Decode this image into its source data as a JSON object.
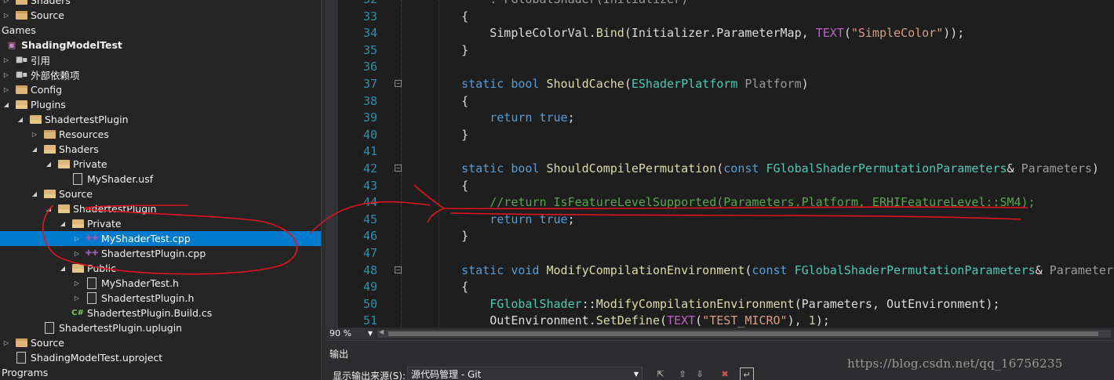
{
  "explorer": {
    "rows": [
      {
        "label": "Shaders",
        "indent": 0,
        "twisty": "closed",
        "icon": "folder",
        "bold": false
      },
      {
        "label": "Source",
        "indent": 0,
        "twisty": "closed",
        "icon": "folder",
        "bold": false
      },
      {
        "label": "Games",
        "indent": -1,
        "twisty": "none",
        "icon": "none",
        "bold": false
      },
      {
        "label": "ShadingModelTest",
        "indent": -1,
        "twisty": "none",
        "icon": "project",
        "bold": true
      },
      {
        "label": "引用",
        "indent": 0,
        "twisty": "closed",
        "icon": "reference",
        "bold": false
      },
      {
        "label": "外部依赖项",
        "indent": 0,
        "twisty": "closed",
        "icon": "reference",
        "bold": false
      },
      {
        "label": "Config",
        "indent": 0,
        "twisty": "closed",
        "icon": "folder",
        "bold": false
      },
      {
        "label": "Plugins",
        "indent": 0,
        "twisty": "open",
        "icon": "folder-open",
        "bold": false
      },
      {
        "label": "ShadertestPlugin",
        "indent": 1,
        "twisty": "open",
        "icon": "folder-open",
        "bold": false
      },
      {
        "label": "Resources",
        "indent": 2,
        "twisty": "closed",
        "icon": "folder",
        "bold": false
      },
      {
        "label": "Shaders",
        "indent": 2,
        "twisty": "open",
        "icon": "folder-open",
        "bold": false
      },
      {
        "label": "Private",
        "indent": 3,
        "twisty": "open",
        "icon": "folder-open",
        "bold": false
      },
      {
        "label": "MyShader.usf",
        "indent": 4,
        "twisty": "none",
        "icon": "file",
        "bold": false
      },
      {
        "label": "Source",
        "indent": 2,
        "twisty": "open",
        "icon": "folder-open",
        "bold": false
      },
      {
        "label": "ShadertestPlugin",
        "indent": 3,
        "twisty": "open",
        "icon": "folder-open",
        "bold": false
      },
      {
        "label": "Private",
        "indent": 4,
        "twisty": "open",
        "icon": "folder-open",
        "bold": false
      },
      {
        "label": "MyShaderTest.cpp",
        "indent": 5,
        "twisty": "closed",
        "icon": "cpp",
        "bold": false,
        "selected": true
      },
      {
        "label": "ShadertestPlugin.cpp",
        "indent": 5,
        "twisty": "closed",
        "icon": "cpp",
        "bold": false
      },
      {
        "label": "Public",
        "indent": 4,
        "twisty": "open",
        "icon": "folder-open",
        "bold": false
      },
      {
        "label": "MyShaderTest.h",
        "indent": 5,
        "twisty": "closed",
        "icon": "file",
        "bold": false
      },
      {
        "label": "ShadertestPlugin.h",
        "indent": 5,
        "twisty": "closed",
        "icon": "file",
        "bold": false
      },
      {
        "label": "ShadertestPlugin.Build.cs",
        "indent": 4,
        "twisty": "none",
        "icon": "cs",
        "bold": false
      },
      {
        "label": "ShadertestPlugin.uplugin",
        "indent": 2,
        "twisty": "none",
        "icon": "file",
        "bold": false
      },
      {
        "label": "Source",
        "indent": 0,
        "twisty": "closed",
        "icon": "folder",
        "bold": false
      },
      {
        "label": "ShadingModelTest.uproject",
        "indent": 0,
        "twisty": "none",
        "icon": "file",
        "bold": false
      },
      {
        "label": "Programs",
        "indent": -1,
        "twisty": "none",
        "icon": "none",
        "bold": false
      }
    ]
  },
  "editor": {
    "lines": [
      {
        "n": "32",
        "fold": false,
        "segs": [
          [
            "prm",
            "        : FGlobalShader(Initializer)"
          ]
        ]
      },
      {
        "n": "33",
        "fold": false,
        "segs": [
          [
            "txt",
            "    {"
          ]
        ]
      },
      {
        "n": "34",
        "fold": false,
        "segs": [
          [
            "txt",
            "        SimpleColorVal."
          ],
          [
            "fn",
            "Bind"
          ],
          [
            "txt",
            "(Initializer.ParameterMap, "
          ],
          [
            "mac",
            "TEXT"
          ],
          [
            "txt",
            "("
          ],
          [
            "str",
            "\"SimpleColor\""
          ],
          [
            "txt",
            "));"
          ]
        ]
      },
      {
        "n": "35",
        "fold": false,
        "segs": [
          [
            "txt",
            "    }"
          ]
        ]
      },
      {
        "n": "36",
        "fold": false,
        "segs": [
          [
            "txt",
            ""
          ]
        ]
      },
      {
        "n": "37",
        "fold": true,
        "segs": [
          [
            "kw",
            "    static bool "
          ],
          [
            "fn",
            "ShouldCache"
          ],
          [
            "txt",
            "("
          ],
          [
            "ty",
            "EShaderPlatform"
          ],
          [
            "prm",
            " Platform"
          ],
          [
            "txt",
            ")"
          ]
        ]
      },
      {
        "n": "38",
        "fold": false,
        "segs": [
          [
            "txt",
            "    {"
          ]
        ]
      },
      {
        "n": "39",
        "fold": false,
        "segs": [
          [
            "kw",
            "        return true"
          ],
          [
            "txt",
            ";"
          ]
        ]
      },
      {
        "n": "40",
        "fold": false,
        "segs": [
          [
            "txt",
            "    }"
          ]
        ]
      },
      {
        "n": "41",
        "fold": false,
        "segs": [
          [
            "txt",
            ""
          ]
        ]
      },
      {
        "n": "42",
        "fold": true,
        "segs": [
          [
            "kw",
            "    static bool "
          ],
          [
            "fn",
            "ShouldCompilePermutation"
          ],
          [
            "txt",
            "("
          ],
          [
            "kw",
            "const "
          ],
          [
            "ty",
            "FGlobalShaderPermutationParameters"
          ],
          [
            "txt",
            "& "
          ],
          [
            "prm",
            "Parameters"
          ],
          [
            "txt",
            ")"
          ]
        ]
      },
      {
        "n": "43",
        "fold": false,
        "segs": [
          [
            "txt",
            "    {"
          ]
        ]
      },
      {
        "n": "44",
        "fold": false,
        "segs": [
          [
            "cm",
            "        //return IsFeatureLevelSupported(Parameters.Platform, ERHIFeatureLevel::SM4);"
          ]
        ]
      },
      {
        "n": "45",
        "fold": false,
        "segs": [
          [
            "kw",
            "        return true"
          ],
          [
            "txt",
            ";"
          ]
        ]
      },
      {
        "n": "46",
        "fold": false,
        "segs": [
          [
            "txt",
            "    }"
          ]
        ]
      },
      {
        "n": "47",
        "fold": false,
        "segs": [
          [
            "txt",
            ""
          ]
        ]
      },
      {
        "n": "48",
        "fold": true,
        "segs": [
          [
            "kw",
            "    static void "
          ],
          [
            "fn",
            "ModifyCompilationEnvironment"
          ],
          [
            "txt",
            "("
          ],
          [
            "kw",
            "const "
          ],
          [
            "ty",
            "FGlobalShaderPermutationParameters"
          ],
          [
            "txt",
            "& "
          ],
          [
            "prm",
            "Parameters"
          ]
        ]
      },
      {
        "n": "49",
        "fold": false,
        "segs": [
          [
            "txt",
            "    {"
          ]
        ]
      },
      {
        "n": "50",
        "fold": false,
        "segs": [
          [
            "ty",
            "        FGlobalShader"
          ],
          [
            "txt",
            "::"
          ],
          [
            "fn",
            "ModifyCompilationEnvironment"
          ],
          [
            "txt",
            "(Parameters, OutEnvironment);"
          ]
        ]
      },
      {
        "n": "51",
        "fold": false,
        "segs": [
          [
            "txt",
            "        OutEnvironment."
          ],
          [
            "fn",
            "SetDefine"
          ],
          [
            "txt",
            "("
          ],
          [
            "mac",
            "TEXT"
          ],
          [
            "txt",
            "("
          ],
          [
            "str",
            "\"TEST_MICRO\""
          ],
          [
            "txt",
            "), "
          ],
          [
            "num",
            "1"
          ],
          [
            "txt",
            ");"
          ]
        ]
      }
    ]
  },
  "status": {
    "zoom": "90 %"
  },
  "output": {
    "title": "输出",
    "source_label": "显示输出来源(S):",
    "source_value": "源代码管理 - Git"
  },
  "watermark": "https://blog.csdn.net/qq_16756235",
  "colors": {
    "selection": "#007acc",
    "annotation": "#e0141e",
    "comment": "#57a64a",
    "keyword": "#569cd6"
  }
}
